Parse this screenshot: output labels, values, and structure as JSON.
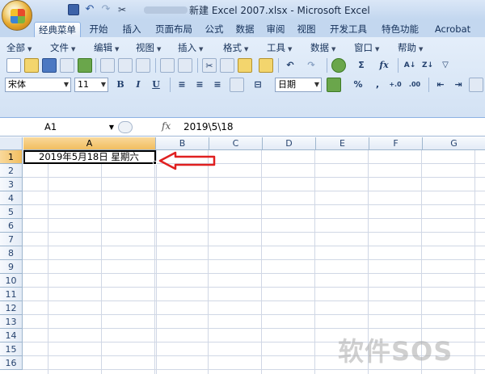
{
  "window": {
    "title": "新建 Excel 2007.xlsx - Microsoft Excel"
  },
  "tabs": [
    "经典菜单",
    "开始",
    "插入",
    "页面布局",
    "公式",
    "数据",
    "审阅",
    "视图",
    "开发工具",
    "特色功能",
    "Acrobat"
  ],
  "menus": [
    "全部",
    "文件",
    "编辑",
    "视图",
    "插入",
    "格式",
    "工具",
    "数据",
    "窗口",
    "帮助"
  ],
  "toolbar": {
    "font_name": "宋体",
    "font_size": "11",
    "bold": "B",
    "italic": "I",
    "underline": "U",
    "number_format": "日期",
    "percent": "%",
    "comma": ",",
    "sum": "Σ",
    "fx": "fx"
  },
  "formula_bar": {
    "name_box": "A1",
    "fx_label": "fx",
    "value": "2019\\5\\18"
  },
  "grid": {
    "columns": [
      "A",
      "B",
      "C",
      "D",
      "E",
      "F",
      "G"
    ],
    "rows": [
      "1",
      "2",
      "3",
      "4",
      "5",
      "6",
      "7",
      "8",
      "9",
      "10",
      "11",
      "12",
      "13",
      "14",
      "15",
      "16"
    ],
    "cell_a1": "2019年5月18日 星期六"
  },
  "watermark": "软件SOS",
  "colors": {
    "selected_header": "#f1bd5f",
    "annotation_arrow": "#e02020",
    "ribbon": "#d3e2f4"
  }
}
